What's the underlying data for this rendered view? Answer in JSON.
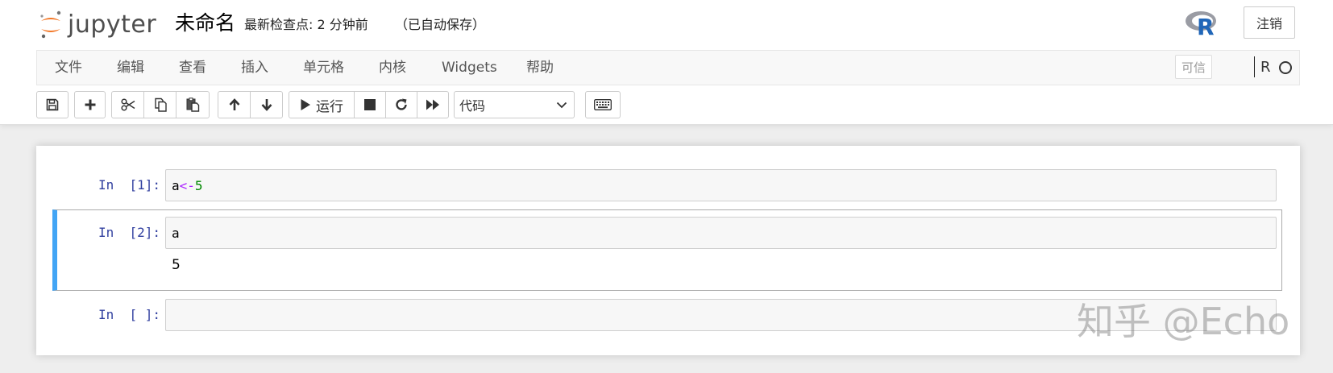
{
  "header": {
    "logo_text": "jupyter",
    "notebook_name": "未命名",
    "checkpoint": "最新检查点: 2 分钟前",
    "autosave": "（已自动保存）",
    "kernel_logo": "R",
    "logout_label": "注销"
  },
  "menubar": {
    "items": [
      {
        "label": "文件"
      },
      {
        "label": "编辑"
      },
      {
        "label": "查看"
      },
      {
        "label": "插入"
      },
      {
        "label": "单元格"
      },
      {
        "label": "内核"
      },
      {
        "label": "Widgets"
      },
      {
        "label": "帮助"
      }
    ],
    "trusted_label": "可信",
    "kernel_name": "R"
  },
  "toolbar": {
    "run_label": "运行",
    "cell_type_selected": "代码",
    "icons": [
      "save-icon",
      "plus-icon",
      "cut-icon",
      "copy-icon",
      "paste-icon",
      "arrow-up-icon",
      "arrow-down-icon",
      "play-icon",
      "stop-icon",
      "restart-icon",
      "fast-forward-icon",
      "keyboard-icon"
    ]
  },
  "cells": [
    {
      "prompt": "In  [1]:",
      "code": {
        "var": "a",
        "op": "<-",
        "num": "5"
      }
    },
    {
      "prompt": "In  [2]:",
      "code": {
        "var": "a"
      },
      "output": "5"
    },
    {
      "prompt": "In  [ ]:",
      "code": {
        "var": ""
      }
    }
  ],
  "watermark": "知乎 @Echo",
  "colors": {
    "prompt": "#303f9f",
    "selected_cell_border": "#42a5f5",
    "operator": "#aa22ff",
    "number": "#008800",
    "logo_orange": "#f37726"
  }
}
